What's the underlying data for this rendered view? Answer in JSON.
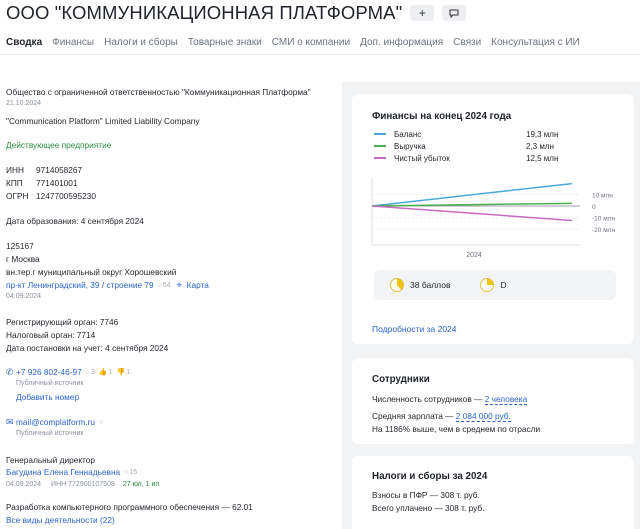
{
  "header": {
    "title": "ООО \"КОММУНИКАЦИОННАЯ ПЛАТФОРМА\"",
    "add_icon": "plus-icon",
    "msg_icon": "comment-icon"
  },
  "tabs": [
    "Сводка",
    "Финансы",
    "Налоги и сборы",
    "Товарные знаки",
    "СМИ о компании",
    "Доп. информация",
    "Связи",
    "Консультация с ИИ"
  ],
  "company": {
    "full_name": "Общество с ограниченной ответственностью \"Коммуникационная Платформа\"",
    "name_date": "21.10.2024",
    "english_name": "\"Communication Platform\" Limited Liability Company",
    "status": "Действующее предприятие",
    "inn_label": "ИНН",
    "inn": "9714058267",
    "kpp_label": "КПП",
    "kpp": "771401001",
    "ogrn_label": "ОГРН",
    "ogrn": "1247700595230",
    "founded": "Дата образования: 4 сентября 2024",
    "postcode": "125167",
    "city": "г Москва",
    "district": "вн.тер.г муниципальный округ Хорошевский",
    "street": "пр-кт Ленинградский, 39 / строение 79",
    "street_count": "64",
    "map_link": "Карта",
    "address_date": "04.09.2024",
    "reg_authority": "Регистрирующий орган: 7746",
    "tax_authority": "Налоговый орган: 7714",
    "tax_registration": "Дата постановки на учет: 4 сентября 2024",
    "phone": "+7 926 802-46-97",
    "phone_count": "3",
    "phone_likes": "1",
    "phone_dislikes": "1",
    "phone_source": "Публичный источник",
    "add_phone": "Добавить номер",
    "email": "mail@complatform.ru",
    "email_source": "Публичный источник",
    "director_title": "Генеральный директор",
    "director_name": "Багудина Елена Геннадьевна",
    "director_count": "15",
    "director_date": "04.09.2024",
    "director_inn": "ИНН 772900107508",
    "director_links": "27 юл, 1 ип",
    "activity": "Разработка компьютерного программного обеспечения — 62.01",
    "all_activities": "Все виды деятельности (22)"
  },
  "finance": {
    "title": "Финансы на конец 2024 года",
    "details_link": "Подробности за 2024",
    "score_label": "38 баллов",
    "grade_label": "D",
    "chart_data": {
      "type": "line",
      "x": [
        "",
        "2024"
      ],
      "series": [
        {
          "name": "Баланс",
          "value_label": "19,3 млн",
          "color": "#4aa8d8",
          "values": [
            0,
            19.3
          ]
        },
        {
          "name": "Выручка",
          "value_label": "2,3 млн",
          "color": "#4caf50",
          "values": [
            0,
            2.3
          ]
        },
        {
          "name": "Чистый убыток",
          "value_label": "12,5 млн",
          "color": "#c96bc0",
          "values": [
            0,
            -12.5
          ]
        }
      ],
      "yticks": [
        "10 млн",
        "0",
        "-10 млн",
        "-20 млн"
      ],
      "ylim": [
        -25,
        25
      ]
    }
  },
  "staff": {
    "title": "Сотрудники",
    "headcount_label": "Численность сотрудников —",
    "headcount_value": "2 человека",
    "salary_label": "Средняя зарплата —",
    "salary_value": "2 084 000 руб.",
    "salary_note": "На 1186% выше, чем в среднем по отрасли"
  },
  "taxes": {
    "title": "Налоги и сборы за 2024",
    "pfr": "Взносы в ПФР — 308 т. руб.",
    "total": "Всего уплачено — 308 т. руб."
  }
}
